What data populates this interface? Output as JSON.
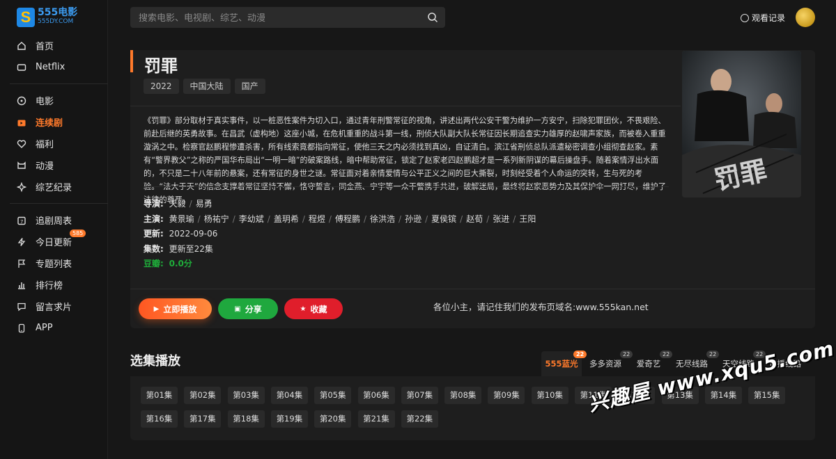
{
  "logo": {
    "title": "555电影",
    "subtitle": "555DY.COM",
    "mark": "S"
  },
  "sidebar": {
    "group1": [
      {
        "label": "首页",
        "icon": "home-icon"
      },
      {
        "label": "Netflix",
        "icon": "tv-icon"
      }
    ],
    "group2": [
      {
        "label": "电影",
        "icon": "film-icon"
      },
      {
        "label": "连续剧",
        "icon": "series-icon",
        "active": true
      },
      {
        "label": "福利",
        "icon": "heart-icon"
      },
      {
        "label": "动漫",
        "icon": "anime-icon"
      },
      {
        "label": "综艺纪录",
        "icon": "sparkle-icon"
      }
    ],
    "group3": [
      {
        "label": "追剧周表",
        "icon": "calendar-icon"
      },
      {
        "label": "今日更新",
        "icon": "bolt-icon",
        "badge": "585"
      },
      {
        "label": "专题列表",
        "icon": "flag-icon"
      },
      {
        "label": "排行榜",
        "icon": "chart-icon"
      },
      {
        "label": "留言求片",
        "icon": "message-icon"
      },
      {
        "label": "APP",
        "icon": "app-icon"
      }
    ]
  },
  "header": {
    "search_placeholder": "搜索电影、电视剧、综艺、动漫",
    "history_label": "观看记录"
  },
  "detail": {
    "title": "罚罪",
    "tags": [
      "2022",
      "中国大陆",
      "国产"
    ],
    "description": "《罚罪》部分取材于真实事件，以一桩恶性案件为切入口，通过青年刑警常征的视角，讲述出两代公安干警为维护一方安宁，扫除犯罪团伙，不畏艰险、前赴后继的英勇故事。在昌武（虚构地）这座小城，在危机重重的战斗第一线，刑侦大队副大队长常征因长期追查实力雄厚的赵啸声家族，而被卷入重重漩涡之中。检察官赵鹏程惨遭杀害，所有线索竟都指向常征，使他三天之内必须找到真凶，自证清白。滨江省刑侦总队派遣秘密调查小组彻查赵家。素有“警界教父”之称的严国华布局出“一明一暗”的破案路线，暗中帮助常征，锁定了赵家老四赵鹏超才是一系列新阴谋的幕后操盘手。随着案情浮出水面的，不只是二十八年前的悬案，还有常征的身世之谜。常征面对着亲情爱情与公平正义之间的巨大撕裂，时刻经受着个人命运的突转，生与死的考验。“法大于天”的信念支撑着常征坚持不懈，恪守誓言，同金燕、宁宇等一众干警携手共进，破解迷局，最终将赵家恶势力及其保护伞一网打尽，维护了法律的尊严。",
    "director_label": "导演:",
    "directors": [
      "天毅",
      "易勇"
    ],
    "cast_label": "主演:",
    "cast": [
      "黄景瑜",
      "杨祐宁",
      "李幼斌",
      "盖玥希",
      "程煜",
      "傅程鹏",
      "徐洪浩",
      "孙逊",
      "夏侯镔",
      "赵荀",
      "张进",
      "王阳"
    ],
    "update_label": "更新:",
    "update_date": "2022-09-06",
    "episodes_label": "集数:",
    "episodes_status": "更新至22集",
    "score_label": "豆瓣:",
    "score": "0.0分",
    "poster_title": "罚罪",
    "buttons": {
      "play": "立即播放",
      "share": "分享",
      "favorite": "收藏"
    },
    "notice": "各位小主，请记住我们的发布页域名:www.555kan.net"
  },
  "episodes_section": {
    "title": "选集播放",
    "sources": [
      {
        "label": "555蓝光",
        "count": "22",
        "active": true
      },
      {
        "label": "多多资源",
        "count": "22"
      },
      {
        "label": "爱奇艺",
        "count": "22"
      },
      {
        "label": "无尽线路",
        "count": "22"
      },
      {
        "label": "天空线路",
        "count": "22"
      },
      {
        "label": "快播线路",
        "count": "22"
      }
    ],
    "episodes": [
      "第01集",
      "第02集",
      "第03集",
      "第04集",
      "第05集",
      "第06集",
      "第07集",
      "第08集",
      "第09集",
      "第10集",
      "第11集",
      "第12集",
      "第13集",
      "第14集",
      "第15集",
      "第16集",
      "第17集",
      "第18集",
      "第19集",
      "第20集",
      "第21集",
      "第22集"
    ]
  },
  "watermark": "兴趣屋 www.xqu5.com",
  "colors": {
    "accent": "#ff7a2b",
    "share": "#1fa83e",
    "favorite": "#e01e2b",
    "score": "#1fad3a",
    "link": "#3b9bf0"
  }
}
